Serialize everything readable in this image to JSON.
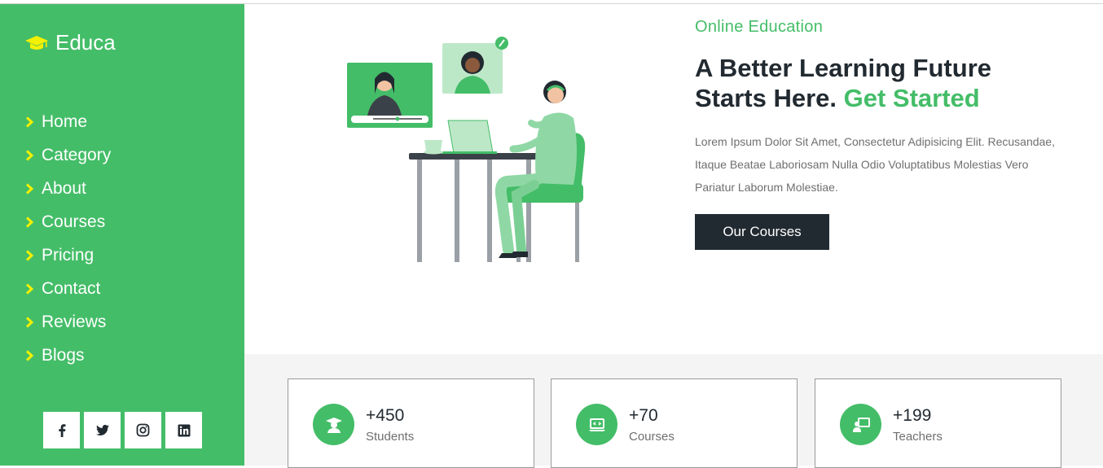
{
  "brand": {
    "name": "Educa",
    "icon": "graduation-cap-icon"
  },
  "nav": {
    "items": [
      {
        "label": "Home"
      },
      {
        "label": "Category"
      },
      {
        "label": "About"
      },
      {
        "label": "Courses"
      },
      {
        "label": "Pricing"
      },
      {
        "label": "Contact"
      },
      {
        "label": "Reviews"
      },
      {
        "label": "Blogs"
      }
    ]
  },
  "social": [
    "facebook-icon",
    "twitter-icon",
    "instagram-icon",
    "linkedin-icon"
  ],
  "hero": {
    "eyebrow": "Online Education",
    "headline_prefix": "A Better Learning Future Starts Here. ",
    "headline_accent": "Get Started",
    "description": "Lorem Ipsum Dolor Sit Amet, Consectetur Adipisicing Elit. Recusandae, Itaque Beatae Laboriosam Nulla Odio Voluptatibus Molestias Vero Pariatur Laborum Molestiae.",
    "cta_label": "Our Courses"
  },
  "stats": [
    {
      "number": "+450",
      "label": "Students",
      "icon": "student-icon"
    },
    {
      "number": "+70",
      "label": "Courses",
      "icon": "laptop-course-icon"
    },
    {
      "number": "+199",
      "label": "Teachers",
      "icon": "teacher-icon"
    }
  ],
  "colors": {
    "accent": "#44bd68",
    "chevron": "#f3f000",
    "dark": "#222a31",
    "text_muted": "#6f6f6f",
    "stats_bg": "#f4f4f4"
  }
}
